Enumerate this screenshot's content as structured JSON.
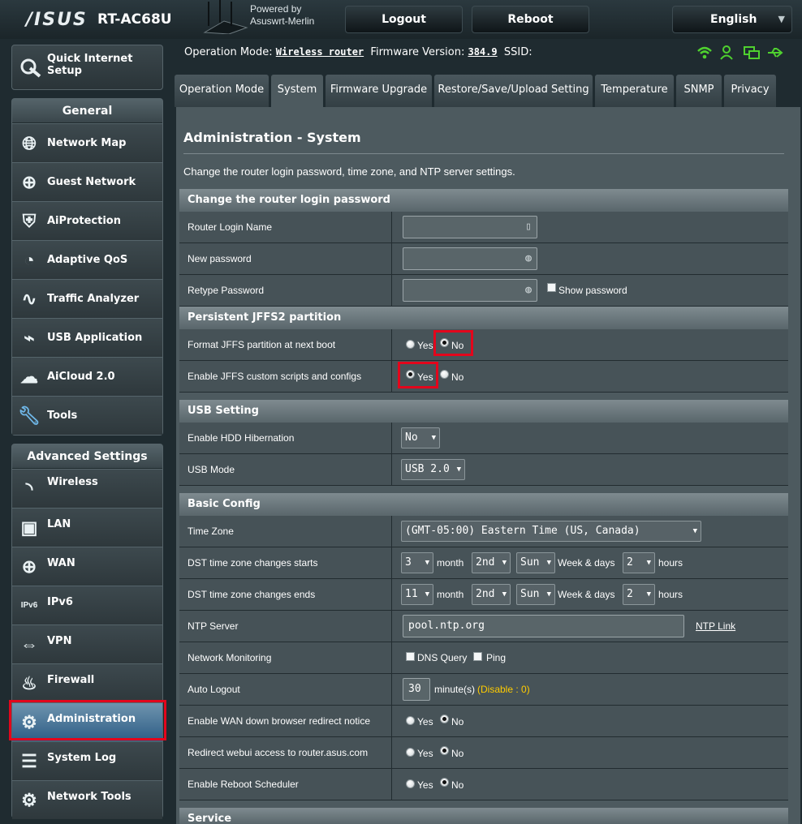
{
  "header": {
    "brand": "/ISUS",
    "model": "RT-AC68U",
    "powered_line1": "Powered by",
    "powered_line2": "Asuswrt-Merlin",
    "logout_label": "Logout",
    "reboot_label": "Reboot",
    "language": "English"
  },
  "status": {
    "operation_mode_label": "Operation Mode:",
    "operation_mode_value": "Wireless router",
    "firmware_label": "Firmware Version:",
    "firmware_value": "384.9",
    "ssid_label": "SSID:"
  },
  "sidebar": {
    "quick_setup_line1": "Quick Internet",
    "quick_setup_line2": "Setup",
    "general_title": "General",
    "general_items": [
      {
        "label": "Network Map",
        "icon": "network-map-icon"
      },
      {
        "label": "Guest Network",
        "icon": "guest-network-icon"
      },
      {
        "label": "AiProtection",
        "icon": "shield-icon"
      },
      {
        "label": "Adaptive QoS",
        "icon": "gauge-icon"
      },
      {
        "label": "Traffic Analyzer",
        "icon": "traffic-icon"
      },
      {
        "label": "USB Application",
        "icon": "usb-icon"
      },
      {
        "label": "AiCloud 2.0",
        "icon": "cloud-icon"
      },
      {
        "label": "Tools",
        "icon": "wrench-icon"
      }
    ],
    "advanced_title": "Advanced Settings",
    "advanced_items": [
      {
        "label": "Wireless",
        "icon": "wifi-icon"
      },
      {
        "label": "LAN",
        "icon": "lan-icon"
      },
      {
        "label": "WAN",
        "icon": "globe-icon"
      },
      {
        "label": "IPv6",
        "icon": "ipv6-icon"
      },
      {
        "label": "VPN",
        "icon": "vpn-icon"
      },
      {
        "label": "Firewall",
        "icon": "firewall-icon"
      },
      {
        "label": "Administration",
        "icon": "admin-gear-icon",
        "active": true
      },
      {
        "label": "System Log",
        "icon": "log-icon"
      },
      {
        "label": "Network Tools",
        "icon": "network-tools-icon"
      }
    ]
  },
  "tabs": [
    "Operation Mode",
    "System",
    "Firmware Upgrade",
    "Restore/Save/Upload Setting",
    "Temperature",
    "SNMP",
    "Privacy"
  ],
  "active_tab": "System",
  "page": {
    "title": "Administration - System",
    "description": "Change the router login password, time zone, and NTP server settings."
  },
  "sections": {
    "login": {
      "title": "Change the router login password",
      "router_login_name": "Router Login Name",
      "new_password": "New password",
      "retype_password": "Retype Password",
      "show_password": "Show password"
    },
    "jffs": {
      "title": "Persistent JFFS2 partition",
      "format_label": "Format JFFS partition at next boot",
      "format_value": "No",
      "scripts_label": "Enable JFFS custom scripts and configs",
      "scripts_value": "Yes"
    },
    "usb": {
      "title": "USB Setting",
      "hibernation_label": "Enable HDD Hibernation",
      "hibernation_value": "No",
      "mode_label": "USB Mode",
      "mode_value": "USB 2.0"
    },
    "basic": {
      "title": "Basic Config",
      "timezone_label": "Time Zone",
      "timezone_value": "(GMT-05:00) Eastern Time (US, Canada)",
      "dst_start_label": "DST time zone changes starts",
      "dst_start": {
        "month": "3",
        "week": "2nd",
        "day": "Sun",
        "hour": "2"
      },
      "dst_end_label": "DST time zone changes ends",
      "dst_end": {
        "month": "11",
        "week": "2nd",
        "day": "Sun",
        "hour": "2"
      },
      "month_text": "month",
      "weekdays_text": "Week & days",
      "hours_text": "hours",
      "ntp_label": "NTP Server",
      "ntp_value": "pool.ntp.org",
      "ntp_link": "NTP Link",
      "monitoring_label": "Network Monitoring",
      "dns_query": "DNS Query",
      "ping": "Ping",
      "autologout_label": "Auto Logout",
      "autologout_value": "30",
      "autologout_unit": "minute(s)",
      "autologout_hint": "(Disable : 0)",
      "wan_redirect_label": "Enable WAN down browser redirect notice",
      "redirect_webui_label": "Redirect webui access to router.asus.com",
      "reboot_scheduler_label": "Enable Reboot Scheduler"
    },
    "service": {
      "title": "Service"
    }
  },
  "yes": "Yes",
  "no": "No"
}
